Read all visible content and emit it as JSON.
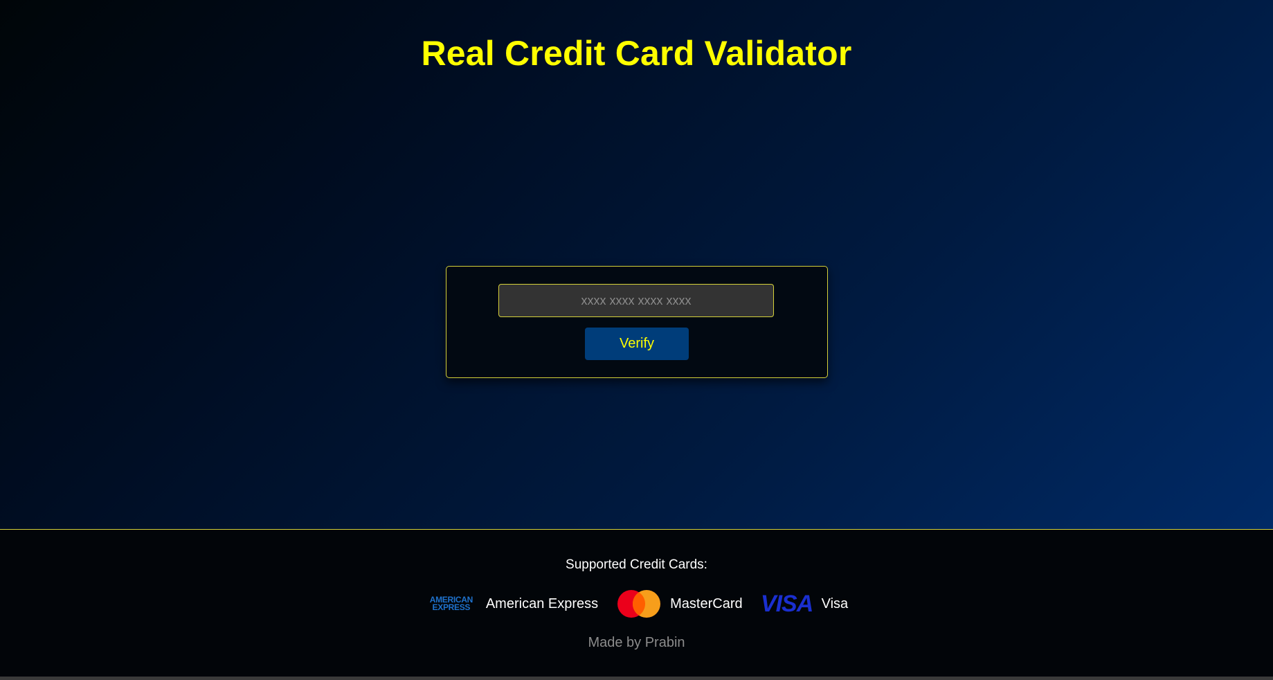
{
  "header": {
    "title": "Real Credit Card Validator"
  },
  "validator": {
    "input_placeholder": "xxxx xxxx xxxx xxxx",
    "input_value": "",
    "verify_label": "Verify"
  },
  "footer": {
    "supported_heading": "Supported Credit Cards:",
    "cards": [
      {
        "name": "American Express",
        "logo_icon": "amex-logo-icon",
        "logo_text_top": "AMERICAN",
        "logo_text_bottom": "EXPRESS"
      },
      {
        "name": "MasterCard",
        "logo_icon": "mastercard-logo-icon"
      },
      {
        "name": "Visa",
        "logo_icon": "visa-logo-icon",
        "logo_text": "VISA"
      }
    ],
    "credit": "Made by Prabin"
  },
  "colors": {
    "accent_yellow": "#ffff00",
    "border_yellow": "#d6d23a",
    "button_blue": "#003d7a",
    "amex_blue": "#1f72cd",
    "visa_blue": "#1a2fd0",
    "mastercard_red": "#eb001b",
    "mastercard_orange": "#f79e1b"
  }
}
